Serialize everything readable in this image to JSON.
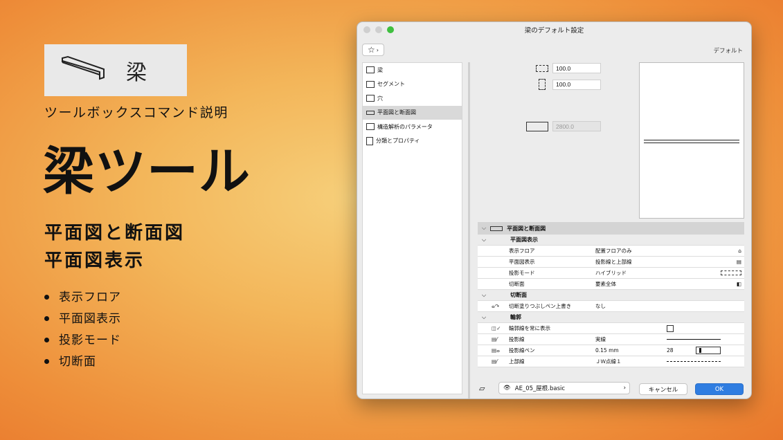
{
  "left": {
    "badge_kanji": "梁",
    "subtitle": "ツールボックスコマンド説明",
    "title": "梁ツール",
    "heading1": "平面図と断面図",
    "heading2": "平面図表示",
    "bullets": [
      "表示フロア",
      "平面図表示",
      "投影モード",
      "切断面"
    ]
  },
  "dialog": {
    "title": "梁のデフォルト設定",
    "default_label": "デフォルト",
    "sidebar": [
      {
        "label": "梁",
        "icon": "beam-icon"
      },
      {
        "label": "セグメント",
        "icon": "segment-icon"
      },
      {
        "label": "穴",
        "icon": "hole-icon"
      },
      {
        "label": "平面図と断面図",
        "icon": "floorplan-icon",
        "selected": true
      },
      {
        "label": "構造解析のパラメータ",
        "icon": "structural-icon"
      },
      {
        "label": "分類とプロパティ",
        "icon": "classification-icon"
      }
    ],
    "fields": {
      "width": "100.0",
      "height": "100.0",
      "offset": "2800.0"
    },
    "panel_title": "平面図と断面図",
    "sections": {
      "plan_display": "平面図表示",
      "cut_surface": "切断面",
      "outline": "輪郭"
    },
    "rows": {
      "show_floor": {
        "label": "表示フロア",
        "value": "配置フロアのみ"
      },
      "plan_display": {
        "label": "平面図表示",
        "value": "投影線と上部線"
      },
      "projection_mode": {
        "label": "投影モード",
        "value": "ハイブリッド"
      },
      "cut_plane": {
        "label": "切断面",
        "value": "要素全体"
      },
      "cut_fill_override": {
        "label": "切断塗りつぶしペン上書き",
        "value": "なし"
      },
      "always_show_outline": {
        "label": "輪郭線を常に表示",
        "value": ""
      },
      "projection_line": {
        "label": "投影線",
        "value": "実線"
      },
      "projection_pen": {
        "label": "投影線ペン",
        "value": "0.15 mm",
        "pen_number": "28"
      },
      "overhead_line": {
        "label": "上部線",
        "value": "ＪＷ点線１"
      }
    },
    "layer": "AE_05_屋根.basic",
    "cancel": "キャンセル",
    "ok": "OK"
  },
  "colors": {
    "accent": "#2f7de1",
    "traffic_red": "#c8c8c8",
    "traffic_green": "#3fbf3f"
  }
}
